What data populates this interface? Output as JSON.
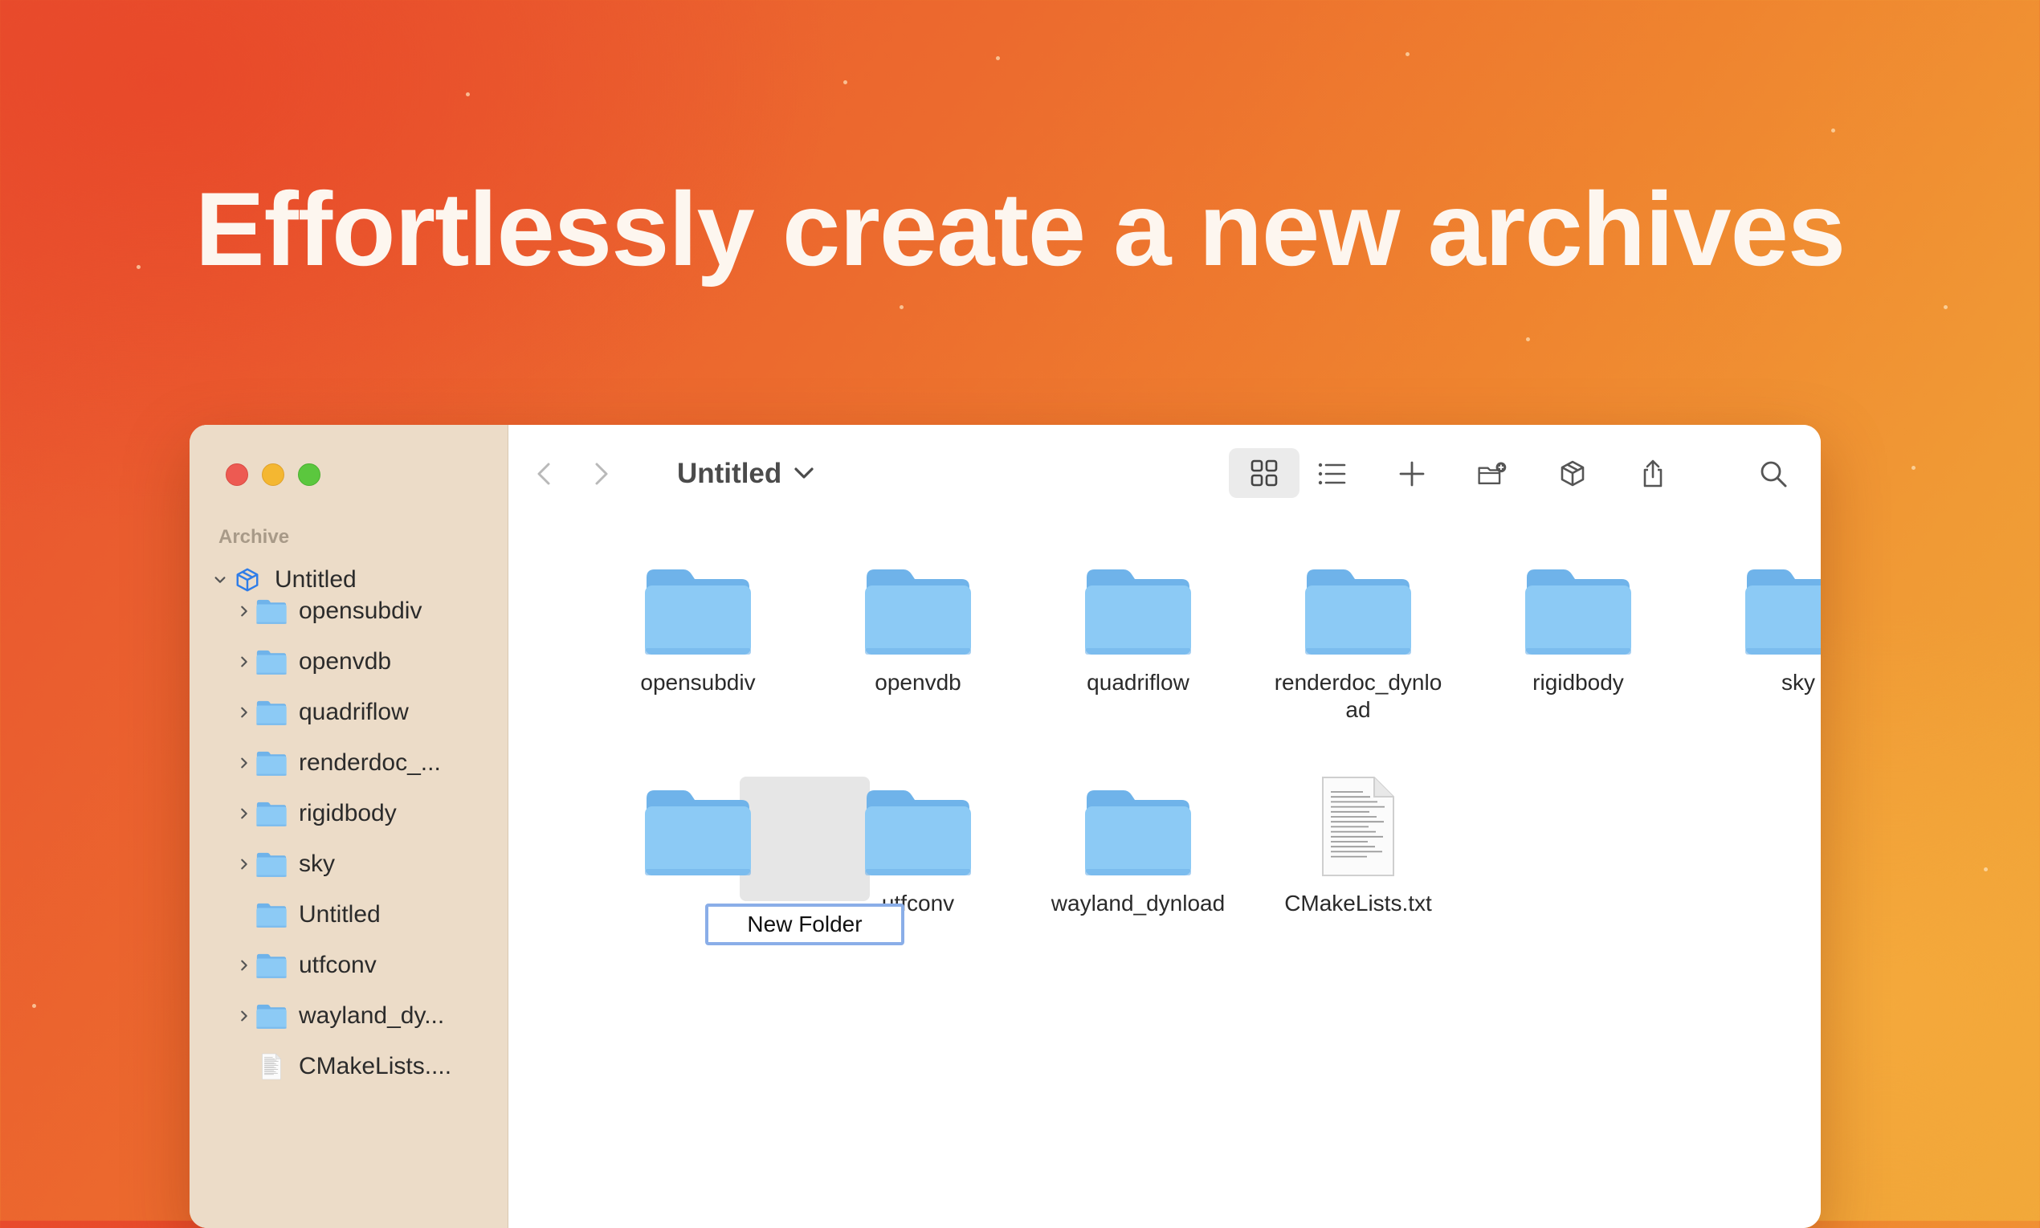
{
  "headline": "Effortlessly create a new archives",
  "colors": {
    "folder_body": "#8ccaf5",
    "folder_tab": "#6fb3ea",
    "accent": "#1a73e8",
    "sidebar_bg": "#ecdcc8"
  },
  "window": {
    "title": "Untitled",
    "toolbar_icons": [
      "chevron-left-icon",
      "chevron-right-icon",
      "chevron-down-icon",
      "grid-view-icon",
      "list-view-icon",
      "plus-icon",
      "new-folder-icon",
      "archive-box-icon",
      "share-icon",
      "search-icon"
    ]
  },
  "sidebar": {
    "section": "Archive",
    "root": {
      "label": "Untitled",
      "icon": "archive-box-icon"
    },
    "items": [
      {
        "label": "opensubdiv",
        "icon": "folder-icon"
      },
      {
        "label": "openvdb",
        "icon": "folder-icon"
      },
      {
        "label": "quadriflow",
        "icon": "folder-icon"
      },
      {
        "label": "renderdoc_...",
        "icon": "folder-icon"
      },
      {
        "label": "rigidbody",
        "icon": "folder-icon"
      },
      {
        "label": "sky",
        "icon": "folder-icon"
      },
      {
        "label": "Untitled",
        "icon": "folder-icon"
      },
      {
        "label": "utfconv",
        "icon": "folder-icon"
      },
      {
        "label": "wayland_dy...",
        "icon": "folder-icon"
      },
      {
        "label": "CMakeLists....",
        "icon": "text-file-icon"
      }
    ]
  },
  "grid": {
    "items": [
      {
        "label": "opensubdiv",
        "icon": "folder-icon"
      },
      {
        "label": "openvdb",
        "icon": "folder-icon"
      },
      {
        "label": "quadriflow",
        "icon": "folder-icon"
      },
      {
        "label": "renderdoc_dynlo\nad",
        "icon": "folder-icon"
      },
      {
        "label": "rigidbody",
        "icon": "folder-icon"
      },
      {
        "label": "sky",
        "icon": "folder-icon"
      },
      {
        "label": "New Folder",
        "icon": "folder-icon"
      },
      {
        "label": "utfconv",
        "icon": "folder-icon"
      },
      {
        "label": "wayland_dynload",
        "icon": "folder-icon"
      },
      {
        "label": "CMakeLists.txt",
        "icon": "text-file-icon"
      }
    ],
    "rename_value": "New Folder"
  }
}
